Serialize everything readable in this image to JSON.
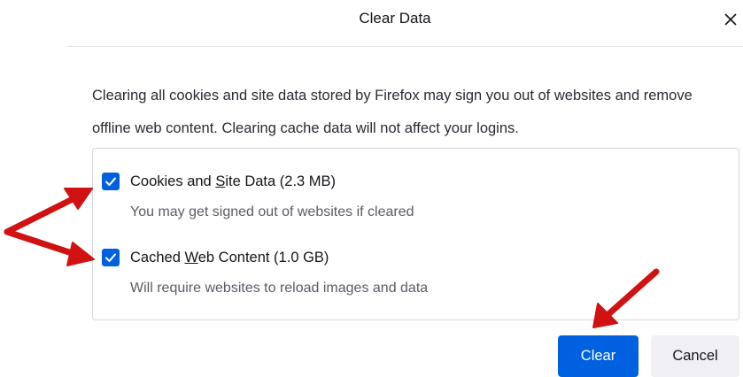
{
  "dialog": {
    "title": "Clear Data",
    "close_icon": "close-icon",
    "description": "Clearing all cookies and site data stored by Firefox may sign you out of websites and remove offline web content. Clearing cache data will not affect your logins."
  },
  "options": [
    {
      "label_before": "Cookies and ",
      "label_access_key": "S",
      "label_after": "ite Data (2.3 MB)",
      "sublabel": "You may get signed out of websites if cleared",
      "checked": true
    },
    {
      "label_before": "Cached ",
      "label_access_key": "W",
      "label_after": "eb Content (1.0 GB)",
      "sublabel": "Will require websites to reload images and data",
      "checked": true
    }
  ],
  "buttons": {
    "clear_label": "Clear",
    "cancel_label": "Cancel"
  },
  "colors": {
    "accent": "#0061e0",
    "annotation_arrow": "#d01212",
    "cancel_bg": "#f0f0f4"
  }
}
